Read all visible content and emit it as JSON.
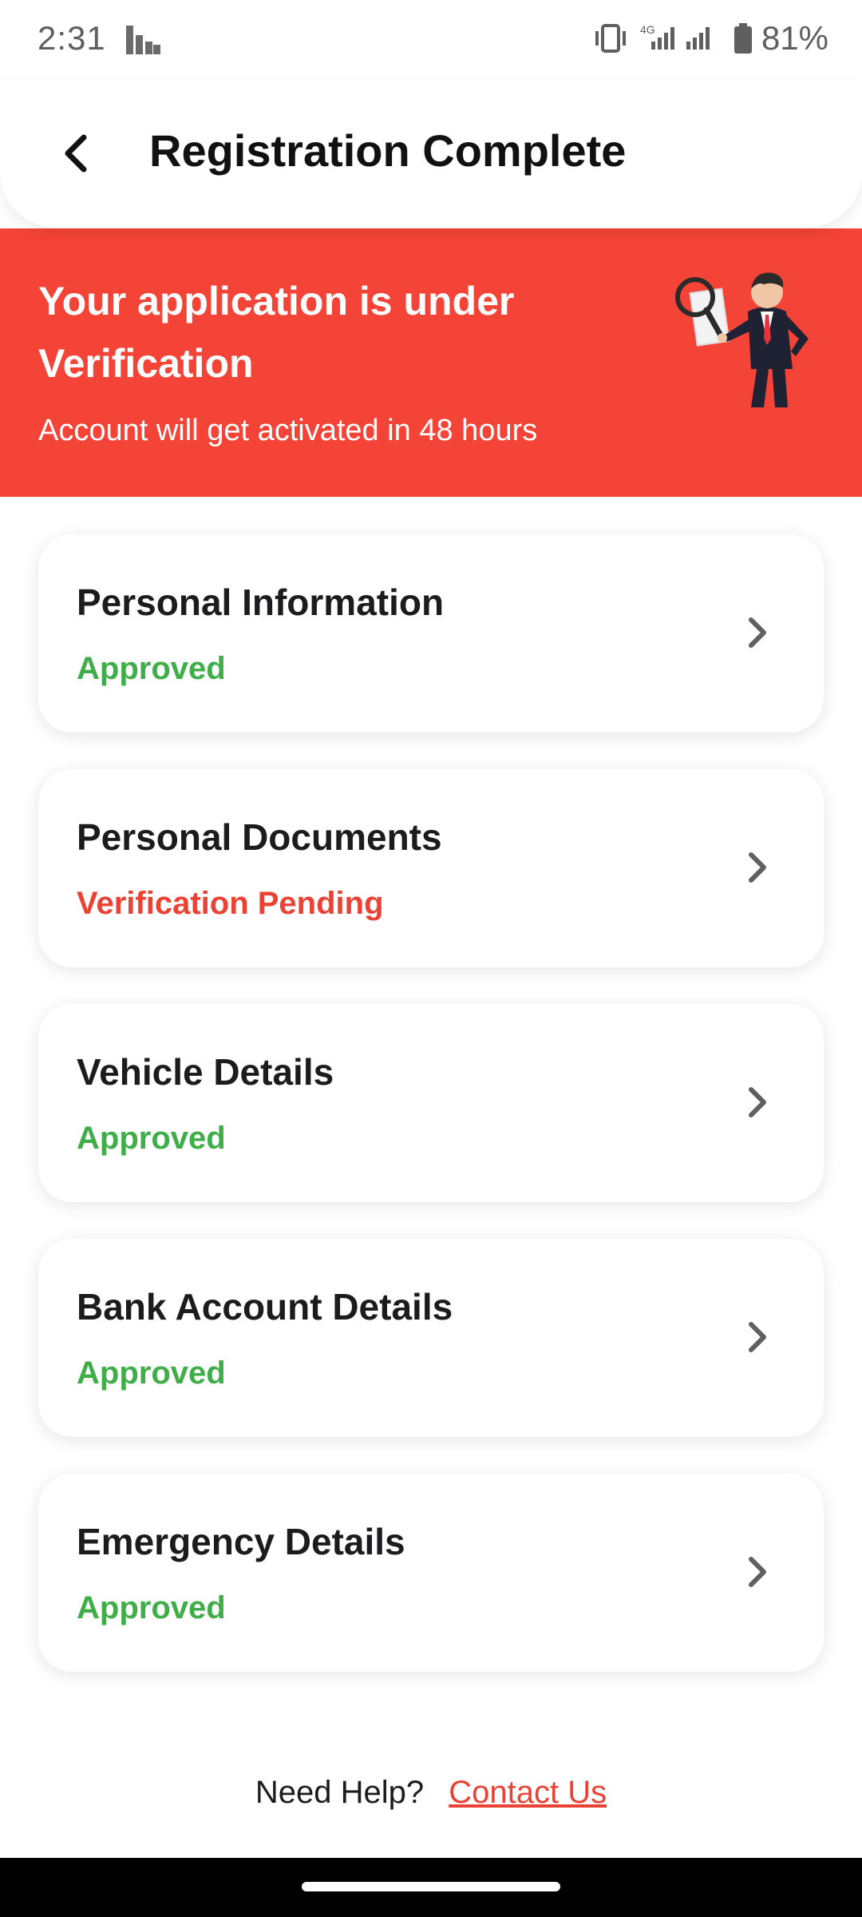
{
  "status_bar": {
    "time": "2:31",
    "battery_percent": "81%",
    "network_type": "4G",
    "icons": [
      "stats-icon",
      "vibrate-icon",
      "signal-icon",
      "battery-icon"
    ]
  },
  "header": {
    "title": "Registration Complete",
    "back_icon": "back-arrow-icon"
  },
  "banner": {
    "title": "Your application is under Verification",
    "subtitle": "Account will get activated in 48 hours",
    "background_color": "#f44337",
    "illustration": "businessman-magnifier-illustration"
  },
  "sections": [
    {
      "title": "Personal Information",
      "status": "Approved"
    },
    {
      "title": "Personal Documents",
      "status": "Verification Pending"
    },
    {
      "title": "Vehicle Details",
      "status": "Approved"
    },
    {
      "title": "Bank Account Details",
      "status": "Approved"
    },
    {
      "title": "Emergency Details",
      "status": "Approved"
    }
  ],
  "colors": {
    "approved": "#3fae49",
    "pending": "#ea4335",
    "accent": "#f44337"
  },
  "footer": {
    "help_text": "Need Help?",
    "contact_link": "Contact Us"
  }
}
